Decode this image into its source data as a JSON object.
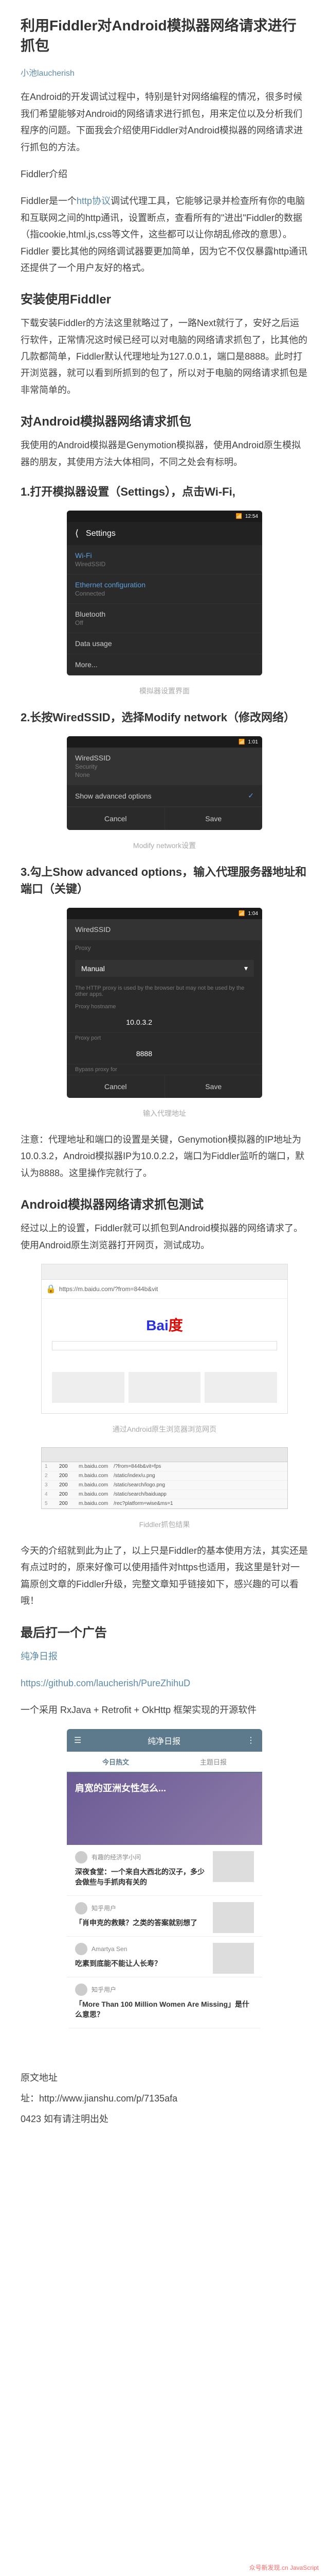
{
  "title": "利用Fiddler对Android模拟器网络请求进行抓包",
  "author": "小池laucherish",
  "intro": "在Android的开发调试过程中，特别是针对网络编程的情况，很多时候我们希望能够对Android的网络请求进行抓包，用来定位以及分析我们程序的问题。下面我会介绍使用Fiddler对Android模拟器的网络请求进行抓包的方法。",
  "s1": {
    "h": "Fiddler介绍",
    "p1": "Fiddler是一个",
    "link": "http协议",
    "p2": "调试代理工具，它能够记录并检查所有你的电脑和互联网之间的http通讯，设置断点，查看所有的\"进出\"Fiddler的数据（指cookie,html,js,css等文件，这些都可以让你胡乱修改的意思）。 Fiddler 要比其他的网络调试器要更加简单，因为它不仅仅暴露http通讯还提供了一个用户友好的格式。"
  },
  "s2": {
    "h": "安装使用Fiddler",
    "p": "下载安装Fiddler的方法这里就略过了，一路Next就行了，安好之后运行软件，正常情况这时候已经可以对电脑的网络请求抓包了，比其他的几款都简单，Fiddler默认代理地址为127.0.0.1，端口是8888。此时打开浏览器，就可以看到所抓到的包了，所以对于电脑的网络请求抓包是非常简单的。"
  },
  "s3": {
    "h": "对Android模拟器网络请求抓包",
    "p": "我使用的Android模拟器是Genymotion模拟器，使用Android原生模拟器的朋友，其使用方法大体相同，不同之处会有标明。"
  },
  "step1": {
    "h": "1.打开模拟器设置（Settings），点击Wi-Fi,",
    "cap": "模拟器设置界面"
  },
  "step2": {
    "h": "2.长按WiredSSID，选择Modify network（修改网络）",
    "cap": "Modify network设置"
  },
  "step3": {
    "h": "3.勾上Show advanced options，输入代理服务器地址和端口（关键）",
    "cap": "输入代理地址"
  },
  "note": "注意：代理地址和端口的设置是关键，Genymotion模拟器的IP地址为10.0.3.2，Android模拟器IP为10.0.2.2，端口为Fiddler监听的端口，默认为8888。这里操作完就行了。",
  "s4": {
    "h": "Android模拟器网络请求抓包测试",
    "p": "经过以上的设置，Fiddler就可以抓包到Android模拟器的网络请求了。使用Android原生浏览器打开网页，测试成功。",
    "cap1": "通过Android原生浏览器浏览网页",
    "cap2": "Fiddler抓包结果"
  },
  "conclusion": "今天的介绍就到此为止了，以上只是Fiddler的基本使用方法，其实还是有点过时的，原来好像可以使用插件对https也适用，我这里是针对一篇原创文章的Fiddler升级，完整文章知乎链接如下，感兴趣的可以看哦！",
  "ad": {
    "h": "最后打一个广告",
    "name": "纯净日报",
    "url": "https://github.com/laucherish/PureZhihuD",
    "desc": "一个采用 RxJava + Retrofit + OkHttp 框架实现的开源软件"
  },
  "mock1": {
    "header": "Settings",
    "items": [
      {
        "l": "Wi-Fi",
        "s": "WiredSSID"
      },
      {
        "l": "Ethernet configuration",
        "s": "Connected"
      },
      {
        "l": "Bluetooth",
        "s": "Off"
      },
      {
        "l": "Data usage",
        "s": ""
      },
      {
        "l": "More...",
        "s": ""
      }
    ]
  },
  "mock2": {
    "ssid": "WiredSSID",
    "sec": "None",
    "opt": "Show advanced options",
    "cancel": "Cancel",
    "save": "Save"
  },
  "mock3": {
    "ssid": "WiredSSID",
    "proxy": "Proxy",
    "manual": "Manual",
    "hint": "The HTTP proxy is used by the browser but may not be used by the other apps.",
    "host_l": "Proxy hostname",
    "host": "10.0.3.2",
    "port_l": "Proxy port",
    "port": "8888",
    "bypass_l": "Bypass proxy for",
    "cancel": "Cancel",
    "save": "Save"
  },
  "browser": {
    "url": "https://m.baidu.com/?from=844b&vit"
  },
  "fiddler_rows": [
    {
      "n": "1",
      "c": "200",
      "h": "m.baidu.com",
      "u": "/?from=844b&vit=fps"
    },
    {
      "n": "2",
      "c": "200",
      "h": "m.baidu.com",
      "u": "/static/index/u.png"
    },
    {
      "n": "3",
      "c": "200",
      "h": "m.baidu.com",
      "u": "/static/search/logo.png"
    },
    {
      "n": "4",
      "c": "200",
      "h": "m.baidu.com",
      "u": "/static/search/baiduapp"
    },
    {
      "n": "5",
      "c": "200",
      "h": "m.baidu.com",
      "u": "/rec?platform=wise&ms=1"
    }
  ],
  "app": {
    "title": "纯净日报",
    "tabs": [
      "今日热文",
      "主题日报"
    ],
    "banner": "肩宽的亚洲女性怎么...",
    "items": [
      {
        "u": "有趣的经济学小问",
        "t": "深夜食堂：一个来自大西北的汉子，多少会做些与手抓肉有关的",
        "q": ""
      },
      {
        "u": "知乎用户",
        "t": "「肖申克的救赎？之类的答案就别想了",
        "q": ""
      },
      {
        "u": "Amartya Sen",
        "t": "吃素到底能不能让人长寿？",
        "q": ""
      },
      {
        "u": "知乎用户",
        "t": "「More Than 100 Million Women Are Missing」是什么意思？",
        "q": ""
      }
    ]
  },
  "footer": {
    "l1": "原文地址",
    "l2": "址：http://www.jianshu.com/p/7135afa",
    "l3": "0423 如有请注明出处"
  },
  "bottom": "众号新发现.cn JavaScript"
}
